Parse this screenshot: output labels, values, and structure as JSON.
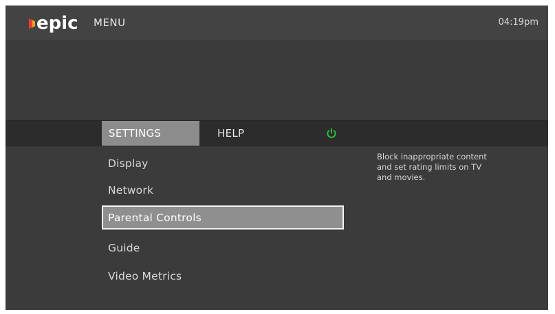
{
  "header": {
    "logo_text": "epic",
    "menu_title": "MENU",
    "clock": "04:19pm"
  },
  "tabs": [
    {
      "label": "SETTINGS",
      "selected": true
    },
    {
      "label": "HELP",
      "selected": false
    }
  ],
  "power_icon_color": "#2fbf3a",
  "menu": {
    "items": [
      {
        "label": "Display"
      },
      {
        "label": "Network"
      },
      {
        "label": "Parental Controls",
        "selected": true
      },
      {
        "label": "Guide"
      },
      {
        "label": "Video Metrics"
      }
    ]
  },
  "description": "Block inappropriate content and set rating limits on TV and movies."
}
